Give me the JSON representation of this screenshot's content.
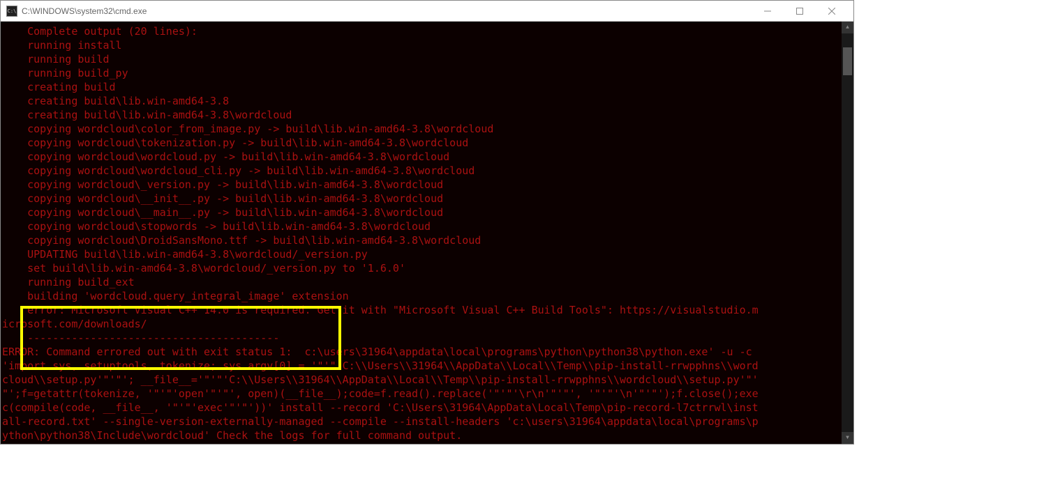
{
  "window": {
    "title": "C:\\WINDOWS\\system32\\cmd.exe",
    "icon_label": "C:\\"
  },
  "terminal": {
    "lines": [
      "    Complete output (20 lines):",
      "    running install",
      "    running build",
      "    running build_py",
      "    creating build",
      "    creating build\\lib.win-amd64-3.8",
      "    creating build\\lib.win-amd64-3.8\\wordcloud",
      "    copying wordcloud\\color_from_image.py -> build\\lib.win-amd64-3.8\\wordcloud",
      "    copying wordcloud\\tokenization.py -> build\\lib.win-amd64-3.8\\wordcloud",
      "    copying wordcloud\\wordcloud.py -> build\\lib.win-amd64-3.8\\wordcloud",
      "    copying wordcloud\\wordcloud_cli.py -> build\\lib.win-amd64-3.8\\wordcloud",
      "    copying wordcloud\\_version.py -> build\\lib.win-amd64-3.8\\wordcloud",
      "    copying wordcloud\\__init__.py -> build\\lib.win-amd64-3.8\\wordcloud",
      "    copying wordcloud\\__main__.py -> build\\lib.win-amd64-3.8\\wordcloud",
      "    copying wordcloud\\stopwords -> build\\lib.win-amd64-3.8\\wordcloud",
      "    copying wordcloud\\DroidSansMono.ttf -> build\\lib.win-amd64-3.8\\wordcloud",
      "    UPDATING build\\lib.win-amd64-3.8\\wordcloud/_version.py",
      "    set build\\lib.win-amd64-3.8\\wordcloud/_version.py to '1.6.0'",
      "    running build_ext",
      "    building 'wordcloud.query_integral_image' extension",
      "    error: Microsoft Visual C++ 14.0 is required. Get it with \"Microsoft Visual C++ Build Tools\": https://visualstudio.m",
      "icrosoft.com/downloads/",
      "    ----------------------------------------",
      "ERROR: Command errored out with exit status 1:  c:\\users\\31964\\appdata\\local\\programs\\python\\python38\\python.exe' -u -c ",
      "'import sys, setuptools, tokenize; sys.argv[0] = '\"'\"'C:\\\\Users\\\\31964\\\\AppData\\\\Local\\\\Temp\\\\pip-install-rrwpphns\\\\word",
      "cloud\\\\setup.py'\"'\"'; __file__='\"'\"'C:\\\\Users\\\\31964\\\\AppData\\\\Local\\\\Temp\\\\pip-install-rrwpphns\\\\wordcloud\\\\setup.py'\"'",
      "\"';f=getattr(tokenize, '\"'\"'open'\"'\"', open)(__file__);code=f.read().replace('\"'\"'\\r\\n'\"'\"', '\"'\"'\\n'\"'\"');f.close();exe",
      "c(compile(code, __file__, '\"'\"'exec'\"'\"'))' install --record 'C:\\Users\\31964\\AppData\\Local\\Temp\\pip-record-l7ctrrwl\\inst",
      "all-record.txt' --single-version-externally-managed --compile --install-headers 'c:\\users\\31964\\appdata\\local\\programs\\p",
      "ython\\python38\\Include\\wordcloud' Check the logs for full command output."
    ]
  },
  "highlight": {
    "description": "yellow-box-around-error"
  }
}
